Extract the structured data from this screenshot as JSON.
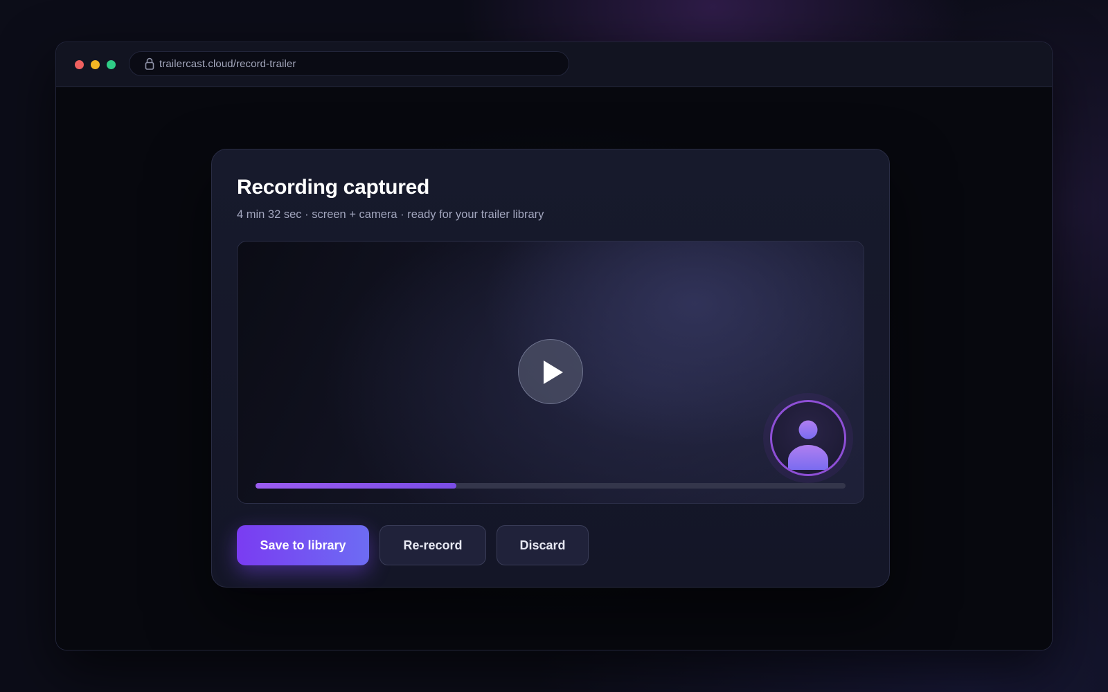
{
  "browser": {
    "url": "trailercast.cloud/record-trailer",
    "traffic_lights": [
      "#f0605f",
      "#f4b624",
      "#2fcd86"
    ]
  },
  "dialog": {
    "title": "Recording captured",
    "subtitle": "4 min 32 sec · screen + camera · ready for your trailer library",
    "player": {
      "play_icon": "play-icon",
      "avatar_icon": "user-icon",
      "progress": 0.34
    },
    "actions": {
      "save": "Save to library",
      "rerecord": "Re-record",
      "discard": "Discard"
    }
  },
  "colors": {
    "accent": "#7a3cf2",
    "accent_end": "#6d6cf3",
    "progress": "#9b5cf0"
  }
}
